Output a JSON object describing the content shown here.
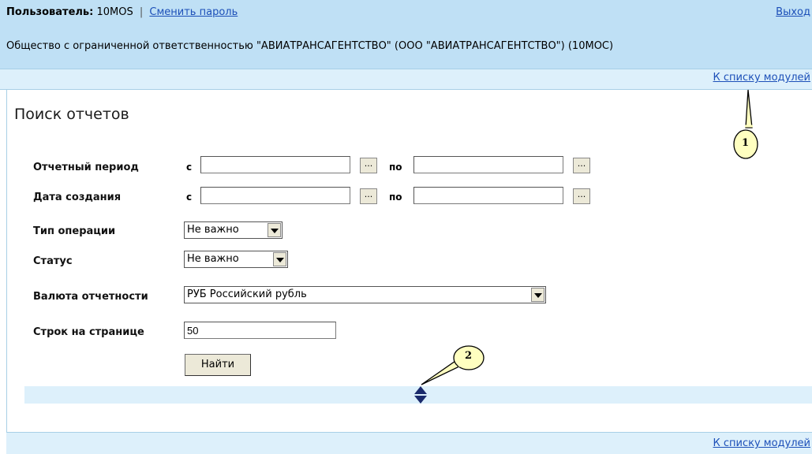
{
  "header": {
    "user_label": "Пользователь:",
    "user_value": "10MOS",
    "separator": "|",
    "change_password": "Сменить пароль",
    "logout": "Выход",
    "organization": "Общество с ограниченной ответственностью \"АВИАТРАНСАГЕНТСТВО\" (ООО \"АВИАТРАНСАГЕНТСТВО\") (10MOC)"
  },
  "nav": {
    "modules_link_top": "К списку модулей",
    "modules_link_bottom": "К списку модулей"
  },
  "page": {
    "title": "Поиск отчетов"
  },
  "form": {
    "period_label": "Отчетный период",
    "created_label": "Дата создания",
    "from_label": "с",
    "to_label": "по",
    "dots": "...",
    "period_from": "",
    "period_to": "",
    "created_from": "",
    "created_to": "",
    "op_type_label": "Тип операции",
    "op_type_value": "Не важно",
    "status_label": "Статус",
    "status_value": "Не важно",
    "currency_label": "Валюта отчетности",
    "currency_value": "РУБ Российский рубль",
    "rows_label": "Строк на странице",
    "rows_value": "50",
    "search_button": "Найти"
  },
  "callouts": {
    "one": "1",
    "two": "2"
  },
  "colors": {
    "header_bg": "#bfe0f5",
    "bar_bg": "#ddf0fb",
    "link": "#1c4fb8",
    "callout_fill": "#ffffc0",
    "splitter_arrow": "#1a2a6c"
  }
}
